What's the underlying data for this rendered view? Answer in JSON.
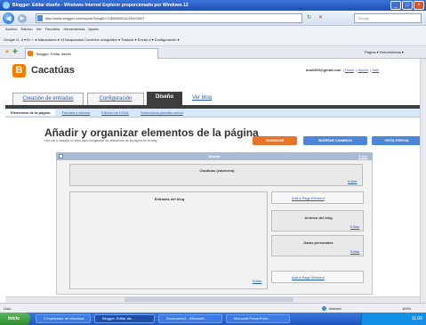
{
  "window": {
    "title": "Blogger: Editar diseño - Windows Internet Explorer proporcionado por Windows 12",
    "min_label": "_",
    "max_label": "□",
    "close_label": "×"
  },
  "browser": {
    "back_label": "◀",
    "forward_label": "▶",
    "url": "http://www.blogger.com/layout?blogID=1360955014235403007",
    "search_placeholder": "Google",
    "menu_items": [
      "Archivo",
      "Edición",
      "Ver",
      "Favoritos",
      "Herramientas",
      "Ayuda"
    ],
    "toolbar_text": "Google  G-        Ir  ▾   M  ☆  ▾   Marcadores ▾   19 bloqueados   Corrector ortográfico ▾   Traducir ▾   Enviar a ▾        Configuración ▾",
    "tab_label": "Blogger: Editar diseño",
    "page_tools_text": "Página ▾   Herramientas ▾"
  },
  "blogger": {
    "logo_letter": "B",
    "blog_name": "Cacatúas",
    "user_email": "ana0469@gmail.com",
    "user_links": [
      "Panel",
      "Ayuda",
      "Salir"
    ],
    "main_tabs": [
      {
        "label": "Creación de entradas"
      },
      {
        "label": "Configuración"
      },
      {
        "label": "Diseño"
      },
      {
        "label": "Ver blog"
      }
    ],
    "sub_tabs": [
      "Elementos de la página",
      "Fuentes y colores",
      "Edición de HTML",
      "Seleccionar plantilla nueva"
    ]
  },
  "page": {
    "title": "Añadir y organizar elementos de la página",
    "subtitle": "Haz clic y arrastra el ratón para reorganizar los elementos de la página en tu blog.",
    "save_button": "GUARDAR",
    "clear_button": "BORRAR CAMBIOS",
    "preview_button": "VISTA PREVIA"
  },
  "layout": {
    "navbar_label": "Navbar",
    "edit_label": "Editar",
    "header_widget": "Cacatúas (cabecera)",
    "blog_posts": "Entradas del blog",
    "add_element": "Add a Page Element",
    "archive_widget": "Archivo del blog",
    "profile_widget": "Datos personales"
  },
  "status": {
    "text": "Listo",
    "zone": "Internet",
    "zoom": "100%"
  },
  "taskbar": {
    "start": "Inicio",
    "items": [
      "3 Explorador de Windows",
      "Blogger: Editar dis...",
      "Documento1 - Microsoft...",
      "Microsoft PowerPoint..."
    ],
    "clock": "11:06"
  },
  "colors": {
    "titlebar": "#1b4fb5",
    "blogger_orange": "#f57d00",
    "save_button": "#e8742a",
    "blue_button": "#4d86d6",
    "navbar_bar": "#a9bcd4"
  }
}
